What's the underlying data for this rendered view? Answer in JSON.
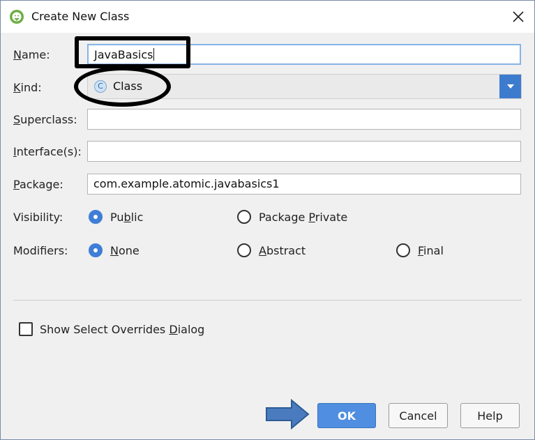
{
  "window": {
    "title": "Create New Class",
    "title_icon": "android-studio-icon",
    "close_icon": "close-icon"
  },
  "form": {
    "name": {
      "label_underlined": "N",
      "label_rest": "ame:",
      "value": "JavaBasics"
    },
    "kind": {
      "label_underlined": "K",
      "label_rest": "ind:",
      "value": "Class",
      "value_icon_letter": "C"
    },
    "superclass": {
      "label_underlined": "S",
      "label_rest": "uperclass:",
      "value": ""
    },
    "interfaces": {
      "label_underlined": "I",
      "label_rest": "nterface(s):",
      "value": ""
    },
    "package": {
      "label_underlined": "P",
      "label_rest": "ackage:",
      "value": "com.example.atomic.javabasics1"
    }
  },
  "visibility": {
    "label": "Visibility:",
    "options": [
      {
        "pre": "Pu",
        "u": "b",
        "post": "lic",
        "selected": true
      },
      {
        "pre": "Package ",
        "u": "P",
        "post": "rivate",
        "selected": false
      }
    ]
  },
  "modifiers": {
    "label": "Modifiers:",
    "options": [
      {
        "pre": "",
        "u": "N",
        "post": "one",
        "selected": true
      },
      {
        "pre": "",
        "u": "A",
        "post": "bstract",
        "selected": false
      },
      {
        "pre": "",
        "u": "F",
        "post": "inal",
        "selected": false
      }
    ]
  },
  "overrides": {
    "pre": "Show Select Overrides ",
    "u": "D",
    "post": "ialog",
    "checked": false
  },
  "buttons": {
    "ok": "OK",
    "cancel": "Cancel",
    "help": "Help"
  },
  "colors": {
    "accent": "#3f7ed6",
    "ok_button": "#4f8ee0",
    "annotation": "#000000",
    "arrow": "#4a7bbf"
  }
}
